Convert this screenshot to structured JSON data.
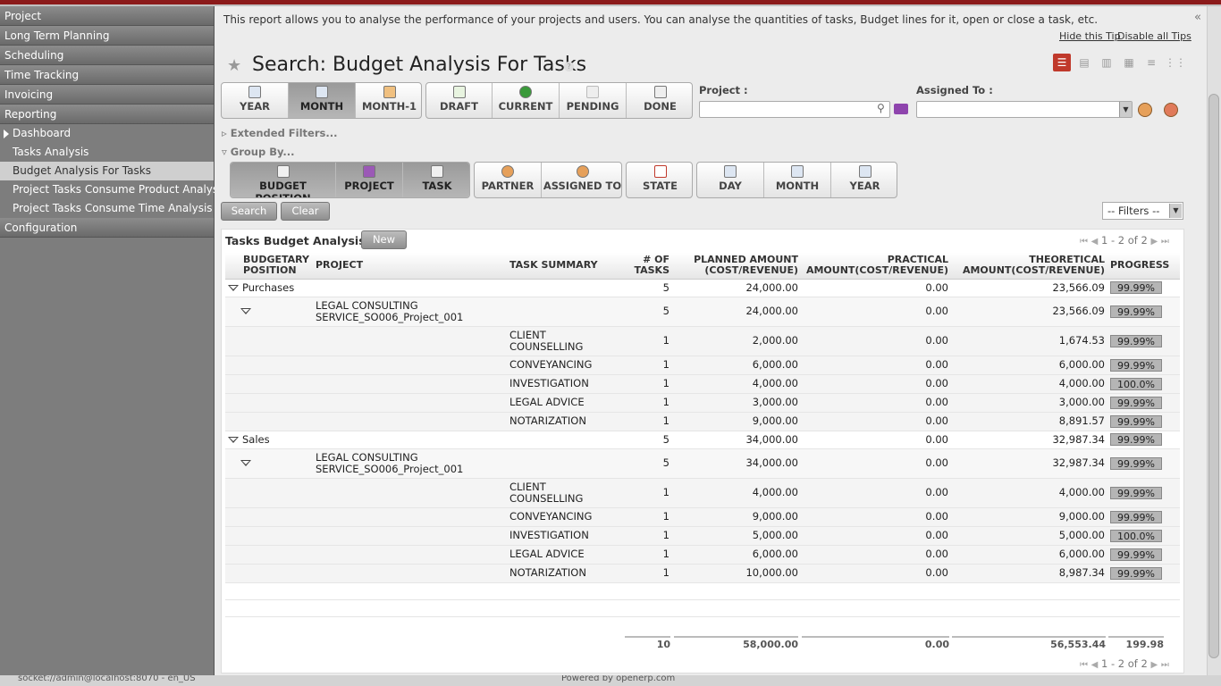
{
  "sidebar": {
    "sections": [
      {
        "label": "Project"
      },
      {
        "label": "Long Term Planning"
      },
      {
        "label": "Scheduling"
      },
      {
        "label": "Time Tracking"
      },
      {
        "label": "Invoicing"
      },
      {
        "label": "Reporting"
      }
    ],
    "reporting_items": [
      {
        "label": "Dashboard"
      },
      {
        "label": "Tasks Analysis"
      },
      {
        "label": "Budget Analysis For Tasks"
      },
      {
        "label": "Project Tasks Consume Product Analysis"
      },
      {
        "label": "Project Tasks Consume Time Analysis"
      }
    ],
    "configuration": "Configuration"
  },
  "tip": {
    "text": "This report allows you to analyse the performance of your projects and users. You can analyse the quantities of tasks, Budget lines for it, open or close a task, etc.",
    "hide": "Hide this Tip",
    "disable": "Disable all Tips"
  },
  "page": {
    "title": "Search: Budget Analysis For Tasks",
    "help": "?"
  },
  "filters": {
    "period": [
      "YEAR",
      "MONTH",
      "MONTH-1"
    ],
    "state": [
      "DRAFT",
      "CURRENT",
      "PENDING",
      "DONE"
    ],
    "project_label": "Project :",
    "assigned_label": "Assigned To :",
    "extended": "Extended Filters...",
    "group_by": "Group By..."
  },
  "groupby": {
    "g1": [
      "BUDGET POSITION",
      "PROJECT",
      "TASK"
    ],
    "g2": [
      "PARTNER",
      "ASSIGNED TO"
    ],
    "g3": [
      "STATE"
    ],
    "g4": [
      "DAY",
      "MONTH",
      "YEAR"
    ]
  },
  "actions": {
    "search": "Search",
    "clear": "Clear",
    "filters": "-- Filters --"
  },
  "list": {
    "title": "Tasks Budget Analysis",
    "new": "New",
    "pager": "1 - 2 of 2",
    "columns": {
      "budgetary_position": "BUDGETARY POSITION",
      "project": "PROJECT",
      "task_summary": "TASK SUMMARY",
      "num_tasks": "# OF TASKS",
      "planned": "PLANNED AMOUNT (COST/REVENUE)",
      "practical": "PRACTICAL AMOUNT(COST/REVENUE)",
      "theoretical": "THEORETICAL AMOUNT(COST/REVENUE)",
      "progress": "PROGRESS"
    },
    "groups": [
      {
        "name": "Purchases",
        "tasks": "5",
        "planned": "24,000.00",
        "practical": "0.00",
        "theoretical": "23,566.09",
        "progress": "99.99%",
        "project": {
          "line1": "LEGAL CONSULTING",
          "line2": "SERVICE_SO006_Project_001",
          "tasks": "5",
          "planned": "24,000.00",
          "practical": "0.00",
          "theoretical": "23,566.09",
          "progress": "99.99%"
        },
        "rows": [
          {
            "l1": "CLIENT",
            "l2": "COUNSELLING",
            "tasks": "1",
            "planned": "2,000.00",
            "practical": "0.00",
            "theoretical": "1,674.53",
            "progress": "99.99%"
          },
          {
            "l1": "CONVEYANCING",
            "l2": "",
            "tasks": "1",
            "planned": "6,000.00",
            "practical": "0.00",
            "theoretical": "6,000.00",
            "progress": "99.99%"
          },
          {
            "l1": "INVESTIGATION",
            "l2": "",
            "tasks": "1",
            "planned": "4,000.00",
            "practical": "0.00",
            "theoretical": "4,000.00",
            "progress": "100.0%"
          },
          {
            "l1": "LEGAL ADVICE",
            "l2": "",
            "tasks": "1",
            "planned": "3,000.00",
            "practical": "0.00",
            "theoretical": "3,000.00",
            "progress": "99.99%"
          },
          {
            "l1": "NOTARIZATION",
            "l2": "",
            "tasks": "1",
            "planned": "9,000.00",
            "practical": "0.00",
            "theoretical": "8,891.57",
            "progress": "99.99%"
          }
        ]
      },
      {
        "name": "Sales",
        "tasks": "5",
        "planned": "34,000.00",
        "practical": "0.00",
        "theoretical": "32,987.34",
        "progress": "99.99%",
        "project": {
          "line1": "LEGAL CONSULTING",
          "line2": "SERVICE_SO006_Project_001",
          "tasks": "5",
          "planned": "34,000.00",
          "practical": "0.00",
          "theoretical": "32,987.34",
          "progress": "99.99%"
        },
        "rows": [
          {
            "l1": "CLIENT",
            "l2": "COUNSELLING",
            "tasks": "1",
            "planned": "4,000.00",
            "practical": "0.00",
            "theoretical": "4,000.00",
            "progress": "99.99%"
          },
          {
            "l1": "CONVEYANCING",
            "l2": "",
            "tasks": "1",
            "planned": "9,000.00",
            "practical": "0.00",
            "theoretical": "9,000.00",
            "progress": "99.99%"
          },
          {
            "l1": "INVESTIGATION",
            "l2": "",
            "tasks": "1",
            "planned": "5,000.00",
            "practical": "0.00",
            "theoretical": "5,000.00",
            "progress": "100.0%"
          },
          {
            "l1": "LEGAL ADVICE",
            "l2": "",
            "tasks": "1",
            "planned": "6,000.00",
            "practical": "0.00",
            "theoretical": "6,000.00",
            "progress": "99.99%"
          },
          {
            "l1": "NOTARIZATION",
            "l2": "",
            "tasks": "1",
            "planned": "10,000.00",
            "practical": "0.00",
            "theoretical": "8,987.34",
            "progress": "99.99%"
          }
        ]
      }
    ],
    "totals": {
      "tasks": "10",
      "planned": "58,000.00",
      "practical": "0.00",
      "theoretical": "56,553.44",
      "progress": "199.98"
    }
  },
  "statusbar": {
    "left": "socket://admin@localhost:8070 - en_US",
    "center": "Powered by openerp.com"
  },
  "colors": {
    "accent": "#c0392b",
    "sidebar": "#7d7d7d",
    "topline": "#8b1a1a"
  }
}
